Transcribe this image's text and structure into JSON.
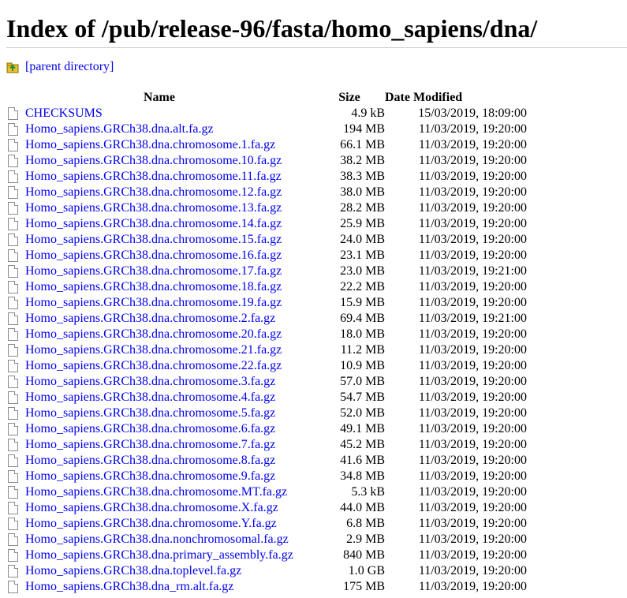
{
  "page": {
    "title": "Index of /pub/release-96/fasta/homo_sapiens/dna/",
    "parent_label": "[parent directory]"
  },
  "table": {
    "headers": {
      "name": "Name",
      "size": "Size",
      "date": "Date Modified"
    },
    "rows": [
      {
        "name": "CHECKSUMS",
        "size": "4.9 kB",
        "date": "15/03/2019, 18:09:00"
      },
      {
        "name": "Homo_sapiens.GRCh38.dna.alt.fa.gz",
        "size": "194 MB",
        "date": "11/03/2019, 19:20:00"
      },
      {
        "name": "Homo_sapiens.GRCh38.dna.chromosome.1.fa.gz",
        "size": "66.1 MB",
        "date": "11/03/2019, 19:20:00"
      },
      {
        "name": "Homo_sapiens.GRCh38.dna.chromosome.10.fa.gz",
        "size": "38.2 MB",
        "date": "11/03/2019, 19:20:00"
      },
      {
        "name": "Homo_sapiens.GRCh38.dna.chromosome.11.fa.gz",
        "size": "38.3 MB",
        "date": "11/03/2019, 19:20:00"
      },
      {
        "name": "Homo_sapiens.GRCh38.dna.chromosome.12.fa.gz",
        "size": "38.0 MB",
        "date": "11/03/2019, 19:20:00"
      },
      {
        "name": "Homo_sapiens.GRCh38.dna.chromosome.13.fa.gz",
        "size": "28.2 MB",
        "date": "11/03/2019, 19:20:00"
      },
      {
        "name": "Homo_sapiens.GRCh38.dna.chromosome.14.fa.gz",
        "size": "25.9 MB",
        "date": "11/03/2019, 19:20:00"
      },
      {
        "name": "Homo_sapiens.GRCh38.dna.chromosome.15.fa.gz",
        "size": "24.0 MB",
        "date": "11/03/2019, 19:20:00"
      },
      {
        "name": "Homo_sapiens.GRCh38.dna.chromosome.16.fa.gz",
        "size": "23.1 MB",
        "date": "11/03/2019, 19:20:00"
      },
      {
        "name": "Homo_sapiens.GRCh38.dna.chromosome.17.fa.gz",
        "size": "23.0 MB",
        "date": "11/03/2019, 19:21:00"
      },
      {
        "name": "Homo_sapiens.GRCh38.dna.chromosome.18.fa.gz",
        "size": "22.2 MB",
        "date": "11/03/2019, 19:20:00"
      },
      {
        "name": "Homo_sapiens.GRCh38.dna.chromosome.19.fa.gz",
        "size": "15.9 MB",
        "date": "11/03/2019, 19:20:00"
      },
      {
        "name": "Homo_sapiens.GRCh38.dna.chromosome.2.fa.gz",
        "size": "69.4 MB",
        "date": "11/03/2019, 19:21:00"
      },
      {
        "name": "Homo_sapiens.GRCh38.dna.chromosome.20.fa.gz",
        "size": "18.0 MB",
        "date": "11/03/2019, 19:20:00"
      },
      {
        "name": "Homo_sapiens.GRCh38.dna.chromosome.21.fa.gz",
        "size": "11.2 MB",
        "date": "11/03/2019, 19:20:00"
      },
      {
        "name": "Homo_sapiens.GRCh38.dna.chromosome.22.fa.gz",
        "size": "10.9 MB",
        "date": "11/03/2019, 19:20:00"
      },
      {
        "name": "Homo_sapiens.GRCh38.dna.chromosome.3.fa.gz",
        "size": "57.0 MB",
        "date": "11/03/2019, 19:20:00"
      },
      {
        "name": "Homo_sapiens.GRCh38.dna.chromosome.4.fa.gz",
        "size": "54.7 MB",
        "date": "11/03/2019, 19:20:00"
      },
      {
        "name": "Homo_sapiens.GRCh38.dna.chromosome.5.fa.gz",
        "size": "52.0 MB",
        "date": "11/03/2019, 19:20:00"
      },
      {
        "name": "Homo_sapiens.GRCh38.dna.chromosome.6.fa.gz",
        "size": "49.1 MB",
        "date": "11/03/2019, 19:20:00"
      },
      {
        "name": "Homo_sapiens.GRCh38.dna.chromosome.7.fa.gz",
        "size": "45.2 MB",
        "date": "11/03/2019, 19:20:00"
      },
      {
        "name": "Homo_sapiens.GRCh38.dna.chromosome.8.fa.gz",
        "size": "41.6 MB",
        "date": "11/03/2019, 19:20:00"
      },
      {
        "name": "Homo_sapiens.GRCh38.dna.chromosome.9.fa.gz",
        "size": "34.8 MB",
        "date": "11/03/2019, 19:20:00"
      },
      {
        "name": "Homo_sapiens.GRCh38.dna.chromosome.MT.fa.gz",
        "size": "5.3 kB",
        "date": "11/03/2019, 19:20:00"
      },
      {
        "name": "Homo_sapiens.GRCh38.dna.chromosome.X.fa.gz",
        "size": "44.0 MB",
        "date": "11/03/2019, 19:20:00"
      },
      {
        "name": "Homo_sapiens.GRCh38.dna.chromosome.Y.fa.gz",
        "size": "6.8 MB",
        "date": "11/03/2019, 19:20:00"
      },
      {
        "name": "Homo_sapiens.GRCh38.dna.nonchromosomal.fa.gz",
        "size": "2.9 MB",
        "date": "11/03/2019, 19:20:00"
      },
      {
        "name": "Homo_sapiens.GRCh38.dna.primary_assembly.fa.gz",
        "size": "840 MB",
        "date": "11/03/2019, 19:20:00"
      },
      {
        "name": "Homo_sapiens.GRCh38.dna.toplevel.fa.gz",
        "size": "1.0 GB",
        "date": "11/03/2019, 19:20:00"
      },
      {
        "name": "Homo_sapiens.GRCh38.dna_rm.alt.fa.gz",
        "size": "175 MB",
        "date": "11/03/2019, 19:20:00"
      }
    ]
  },
  "colors": {
    "link": "#0000ee",
    "rule": "#c8c8c8",
    "folder_fill": "#e8c430",
    "folder_arrow": "#2e8b2e"
  },
  "icons": {
    "parent": "folder-up-icon",
    "file": "file-icon"
  }
}
